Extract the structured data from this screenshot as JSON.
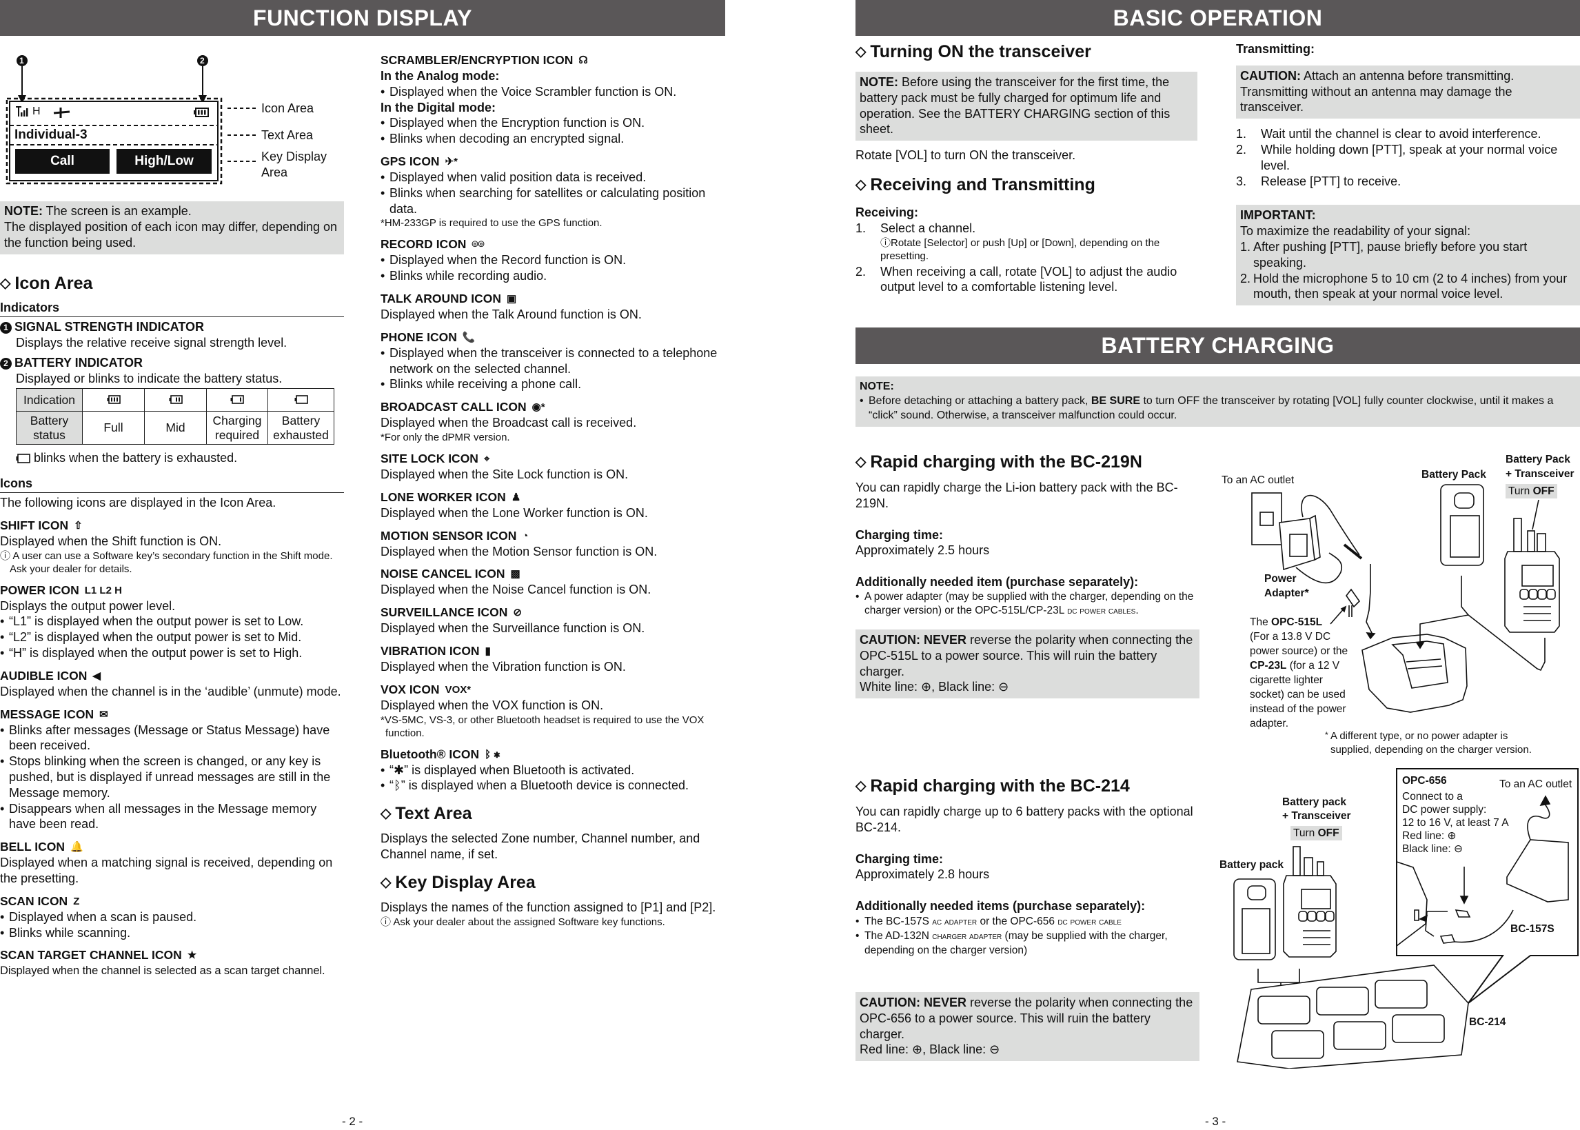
{
  "left_page": {
    "header": "FUNCTION DISPLAY",
    "page_number": "- 2 -",
    "display_diagram": {
      "marker_1": "1",
      "marker_2": "2",
      "icon_row": {
        "signal_icon": "signal-strength-icon",
        "power_text": "H",
        "gps_icon": "gps-icon",
        "battery_icon": "battery-full-icon"
      },
      "text_area_value": "Individual-3",
      "key_1": "Call",
      "key_2": "High/Low",
      "labels": {
        "icon_area": "Icon Area",
        "text_area": "Text Area",
        "key_display_area_1": "Key Display",
        "key_display_area_2": "Area"
      }
    },
    "note": {
      "label": "NOTE:",
      "line1": " The screen is an example.",
      "line2": "The displayed position of each icon may differ, depending on the function being used."
    },
    "icon_area": {
      "heading": "Icon Area",
      "indicators_title": "Indicators",
      "signal": {
        "num": "1",
        "title": "SIGNAL STRENGTH INDICATOR",
        "desc": "Displays the relative receive signal strength level."
      },
      "battery": {
        "num": "2",
        "title": "BATTERY INDICATOR",
        "desc": "Displayed or blinks to indicate the battery status."
      },
      "battery_table": {
        "row1_label": "Indication",
        "row2_label_1": "Battery",
        "row2_label_2": "status",
        "statuses": [
          {
            "icon": "battery-full-icon",
            "label_1": "Full",
            "label_2": ""
          },
          {
            "icon": "battery-mid-icon",
            "label_1": "Mid",
            "label_2": ""
          },
          {
            "icon": "battery-low-icon",
            "label_1": "Charging",
            "label_2": "required"
          },
          {
            "icon": "battery-empty-icon",
            "label_1": "Battery",
            "label_2": "exhausted"
          }
        ]
      },
      "blink_note": "blinks when the battery is exhausted.",
      "icons_title": "Icons",
      "icons_intro": "The following icons are displayed in the Icon Area."
    },
    "col1_icons": [
      {
        "title": "SHIFT ICON",
        "glyph": "⇧",
        "icon": "shift-icon",
        "lines": [
          {
            "t": "Displayed when the Shift function is ON."
          },
          {
            "t": "ⓘ A user can use a Software key’s secondary function in the Shift mode. Ask your dealer for details.",
            "small": true
          }
        ]
      },
      {
        "title": "POWER ICON",
        "glyph": "L1 L2 H",
        "icon": "power-level-icon",
        "lines": [
          {
            "t": "Displays the output power level."
          },
          {
            "t": "“L1” is displayed when the output power is set to Low.",
            "bullet": true
          },
          {
            "t": "“L2” is displayed when the output power is set to Mid.",
            "bullet": true
          },
          {
            "t": "“H” is displayed when the output power is set to High.",
            "bullet": true
          }
        ]
      },
      {
        "title": "AUDIBLE ICON",
        "glyph": "◀",
        "icon": "speaker-icon",
        "lines": [
          {
            "t": "Displayed when the channel is in the ‘audible’ (unmute) mode."
          }
        ]
      },
      {
        "title": "MESSAGE ICON",
        "glyph": "✉",
        "icon": "message-envelope-icon",
        "lines": [
          {
            "t": "Blinks after messages (Message or Status Message) have been received.",
            "bullet": true
          },
          {
            "t": "Stops blinking when the screen is changed, or any key is pushed, but is displayed if unread messages are still in the Message memory.",
            "bullet": true
          },
          {
            "t": "Disappears when all messages in the Message memory have been read.",
            "bullet": true
          }
        ]
      },
      {
        "title": "BELL ICON",
        "glyph": "🔔",
        "icon": "bell-icon",
        "lines": [
          {
            "t": "Displayed when a matching signal is received, depending on the presetting."
          }
        ]
      },
      {
        "title": "SCAN ICON",
        "glyph": "Z",
        "icon": "scan-icon",
        "lines": [
          {
            "t": "Displayed when a scan is paused.",
            "bullet": true
          },
          {
            "t": "Blinks while scanning.",
            "bullet": true
          }
        ]
      },
      {
        "title": "SCAN TARGET CHANNEL ICON",
        "glyph": "★",
        "icon": "star-icon",
        "lines": [
          {
            "t": "Displayed when the channel is selected as a scan target channel.",
            "compact": true
          }
        ]
      }
    ],
    "col2_icons": [
      {
        "title": "SCRAMBLER/ENCRYPTION ICON",
        "glyph": "☊",
        "icon": "scrambler-icon",
        "lines": [
          {
            "t": "In the Analog mode:",
            "bold": true
          },
          {
            "t": "Displayed when the Voice Scrambler function is ON.",
            "bullet": true
          },
          {
            "t": "In the Digital mode:",
            "bold": true
          },
          {
            "t": "Displayed when the Encryption function is ON.",
            "bullet": true
          },
          {
            "t": "Blinks when decoding an encrypted signal.",
            "bullet": true
          }
        ]
      },
      {
        "title": "GPS ICON",
        "glyph": "✈*",
        "icon": "gps-icon",
        "lines": [
          {
            "t": "Displayed when valid position data is received.",
            "bullet": true
          },
          {
            "t": "Blinks when searching for satellites or calculating position data.",
            "bullet": true
          },
          {
            "t": "*HM-233GP is required to use the GPS function.",
            "small": true
          }
        ]
      },
      {
        "title": "RECORD ICON",
        "glyph": "⌾⌾",
        "icon": "record-tape-icon",
        "lines": [
          {
            "t": "Displayed when the Record function is ON.",
            "bullet": true
          },
          {
            "t": "Blinks while recording audio.",
            "bullet": true
          }
        ]
      },
      {
        "title": "TALK AROUND ICON",
        "glyph": "▣",
        "icon": "talk-around-icon",
        "lines": [
          {
            "t": "Displayed when the Talk Around function is ON."
          }
        ]
      },
      {
        "title": "PHONE ICON",
        "glyph": "📞",
        "icon": "phone-icon",
        "lines": [
          {
            "t": "Displayed when the transceiver is connected to a telephone network on the selected channel.",
            "bullet": true
          },
          {
            "t": "Blinks while receiving a phone call.",
            "bullet": true
          }
        ]
      },
      {
        "title": "BROADCAST CALL ICON",
        "glyph": "◉*",
        "icon": "broadcast-icon",
        "lines": [
          {
            "t": "Displayed when the Broadcast call is received."
          },
          {
            "t": "*For only the dPMR version.",
            "small": true
          }
        ]
      },
      {
        "title": "SITE LOCK ICON",
        "glyph": "⌖",
        "icon": "site-lock-icon",
        "lines": [
          {
            "t": "Displayed when the Site Lock function is ON."
          }
        ]
      },
      {
        "title": "LONE WORKER ICON",
        "glyph": "♟",
        "icon": "lone-worker-icon",
        "lines": [
          {
            "t": "Displayed when the Lone Worker function is ON."
          }
        ]
      },
      {
        "title": "MOTION SENSOR ICON",
        "glyph": "◔",
        "icon": "motion-sensor-icon",
        "lines": [
          {
            "t": "Displayed when the Motion Sensor function is ON."
          }
        ]
      },
      {
        "title": "NOISE CANCEL ICON",
        "glyph": "▩",
        "icon": "noise-cancel-icon",
        "lines": [
          {
            "t": "Displayed when the Noise Cancel function is ON."
          }
        ]
      },
      {
        "title": "SURVEILLANCE ICON",
        "glyph": "⊘",
        "icon": "surveillance-icon",
        "lines": [
          {
            "t": "Displayed when the Surveillance function is ON."
          }
        ]
      },
      {
        "title": "VIBRATION ICON",
        "glyph": "▮",
        "icon": "vibration-icon",
        "lines": [
          {
            "t": "Displayed when the Vibration function is ON."
          }
        ]
      },
      {
        "title": "VOX ICON",
        "glyph": "VOX*",
        "icon": "vox-icon",
        "lines": [
          {
            "t": "Displayed when the VOX function is ON."
          },
          {
            "t": "*VS-5MC, VS-3, or other Bluetooth headset is required to use the VOX function.",
            "small": true
          }
        ]
      },
      {
        "title": "Bluetooth® ICON",
        "glyph": "ᛒ ✱",
        "icon": "bluetooth-icon",
        "lines": [
          {
            "t": "“✱” is displayed when Bluetooth is activated.",
            "bullet": true
          },
          {
            "t": "“ᛒ” is displayed when a Bluetooth device is connected.",
            "bullet": true
          }
        ]
      }
    ],
    "text_area": {
      "heading": "Text Area",
      "desc": "Displays the selected Zone number, Channel number, and Channel name, if set."
    },
    "key_display_area": {
      "heading": "Key Display Area",
      "desc": "Displays the names of the function assigned to [P1] and [P2].",
      "tip": "ⓘ Ask your dealer about the assigned Software key functions."
    }
  },
  "right_page": {
    "header": "BASIC OPERATION",
    "page_number": "- 3 -",
    "turning_on": {
      "heading": "Turning ON the transceiver",
      "note_label": "NOTE:",
      "note_text": " Before using the transceiver for the first time, the battery pack must be fully charged for optimum life and operation. See the BATTERY CHARGING section of this sheet.",
      "instruction": "Rotate [VOL] to turn ON the transceiver."
    },
    "rx_tx": {
      "heading": "Receiving and Transmitting",
      "receiving_title": "Receiving:",
      "receiving_steps": [
        {
          "n": "1.",
          "t": "Select a channel.",
          "tip": "ⓘRotate [Selector] or push [Up] or [Down], depending on the presetting."
        },
        {
          "n": "2.",
          "t": "When receiving a call, rotate [VOL] to adjust the audio output level to a comfortable listening level.",
          "tip": ""
        }
      ],
      "transmitting_title": "Transmitting:",
      "caution_label": "CAUTION:",
      "caution_text": " Attach an antenna before transmitting. Transmitting without an antenna may damage the transceiver.",
      "transmitting_steps": [
        {
          "n": "1.",
          "t": "Wait until the channel is clear to avoid interference."
        },
        {
          "n": "2.",
          "t": "While holding down [PTT], speak at your normal voice level."
        },
        {
          "n": "3.",
          "t": "Release [PTT] to receive."
        }
      ],
      "important_label": "IMPORTANT:",
      "important_intro": "To maximize the readability of your signal:",
      "important_items": [
        {
          "n": "1.",
          "t": "After pushing [PTT], pause briefly before you start speaking."
        },
        {
          "n": "2.",
          "t": "Hold the microphone 5 to 10 cm (2 to 4 inches) from your mouth, then speak at your normal voice level."
        }
      ]
    },
    "battery_charging": {
      "header": "BATTERY CHARGING",
      "note_label": "NOTE:",
      "note_pre": "Before detaching or attaching a battery pack, ",
      "note_bold": "BE SURE",
      "note_post": " to turn OFF the transceiver by rotating [VOL] fully counter clockwise, until it makes a “click” sound. Otherwise, a transceiver malfunction could occur.",
      "bc219n": {
        "heading": "Rapid charging with the BC-219N",
        "desc": "You can rapidly charge the Li-ion battery pack with the BC-219N.",
        "time_title": "Charging time:",
        "time_value": "Approximately 2.5 hours",
        "needed_title": "Additionally needed item (purchase separately):",
        "needed_pre": "A power adapter (may be supplied with the charger, depending on the charger version) or the OPC-515L/CP-23L ",
        "needed_sc": "dc power cables",
        "needed_post": ".",
        "caution_label": "CAUTION: NEVER",
        "caution_text": " reverse the polarity when connecting the OPC-515L to a power source. This will ruin the battery charger.",
        "caution_lines": "White line: ⊕, Black line: ⊖",
        "diagram": {
          "ac_outlet": "To an AC outlet",
          "battery_pack": "Battery Pack",
          "bp_transceiver_1": "Battery Pack",
          "bp_transceiver_2": "+ Transceiver",
          "turn": "Turn ",
          "off": "OFF",
          "power_adapter_1": "Power",
          "power_adapter_2": "Adapter*",
          "opc_pre": "The ",
          "opc_bold": "OPC-515L",
          "opc_l2": "(For a 13.8 V DC",
          "opc_l3": "power source) or the",
          "cp_bold": "CP-23L",
          "cp_l4": " (for a 12 V",
          "opc_l5": "cigarette lighter",
          "opc_l6": "socket) can be used",
          "opc_l7": "instead of the power",
          "opc_l8": "adapter.",
          "footnote_1": "A different type, or no power adapter is",
          "footnote_2": "supplied, depending on the charger version."
        }
      },
      "bc214": {
        "heading": "Rapid charging with the BC-214",
        "desc": "You can rapidly charge up to 6 battery packs with the optional BC-214.",
        "time_title": "Charging time:",
        "time_value": "Approximately 2.8 hours",
        "needed_title": "Additionally needed items (purchase separately):",
        "needed_items": [
          {
            "pre": "The BC-157S ",
            "sc": "ac adapter",
            "mid": " or the OPC-656 ",
            "sc2": "dc power cable",
            "post": ""
          },
          {
            "pre": "The AD-132N ",
            "sc": "charger adapter",
            "mid": " (may be supplied with the charger, depending on the charger version)",
            "sc2": "",
            "post": ""
          }
        ],
        "caution_label": "CAUTION: NEVER",
        "caution_text": " reverse the polarity when connecting the OPC-656 to a power source. This will ruin the battery charger.",
        "caution_lines": "Red line: ⊕, Black line: ⊖",
        "diagram": {
          "bp_transceiver_1": "Battery pack",
          "bp_transceiver_2": "+ Transceiver",
          "turn": "Turn ",
          "off": "OFF",
          "battery_pack": "Battery pack",
          "opc656": "OPC-656",
          "ac_outlet": "To an AC outlet",
          "connect_1": "Connect to a",
          "connect_2": "DC power supply:",
          "connect_3": "12 to 16 V, at least 7 A",
          "red_line": "Red line:   ⊕",
          "black_line": "Black line: ⊖",
          "bc157s": "BC-157S",
          "bc214": "BC-214"
        }
      }
    }
  }
}
